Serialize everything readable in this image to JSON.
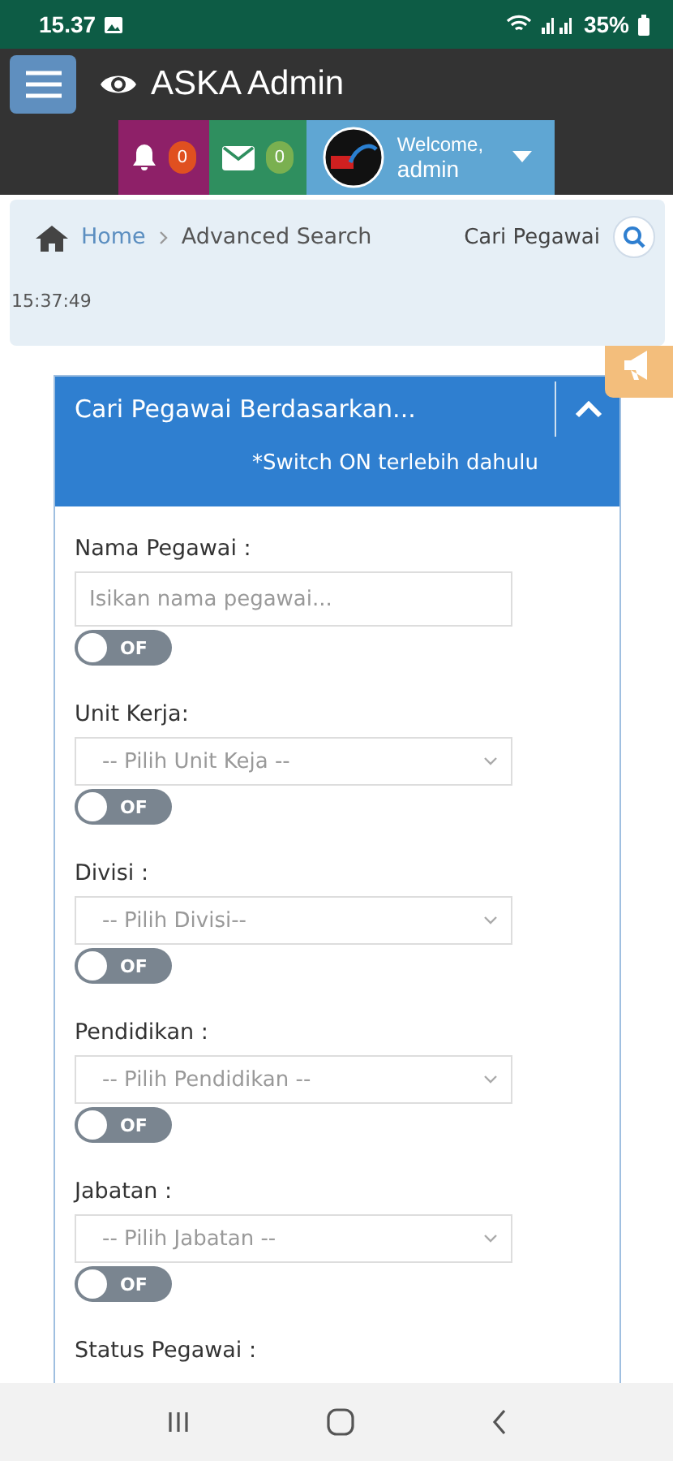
{
  "status_bar": {
    "time": "15.37",
    "battery": "35%"
  },
  "app_bar": {
    "title": "ASKA Admin"
  },
  "header_buttons": {
    "notifications": "0",
    "messages": "0",
    "welcome": "Welcome,",
    "user": "admin"
  },
  "breadcrumb": {
    "items": [
      {
        "label": "Home",
        "kind": "link"
      },
      {
        "label": "Advanced Search",
        "kind": "current"
      }
    ],
    "search_placeholder": "Cari Pegawai",
    "time": "15:37:49"
  },
  "card": {
    "title": "Cari Pegawai Berdasarkan...",
    "note": "*Switch ON terlebih dahulu",
    "expanded": true,
    "fields": [
      {
        "label": "Nama Pegawai :",
        "kind": "input",
        "placeholder": "Isikan nama pegawai...",
        "switch": {
          "on": false,
          "label": "OF"
        }
      },
      {
        "label": "Unit Kerja:",
        "kind": "select",
        "value": "-- Pilih Unit Keja --",
        "switch": {
          "on": false,
          "label": "OF"
        }
      },
      {
        "label": "Divisi :",
        "kind": "select",
        "value": "-- Pilih Divisi--",
        "switch": {
          "on": false,
          "label": "OF"
        }
      },
      {
        "label": "Pendidikan :",
        "kind": "select",
        "value": "-- Pilih Pendidikan --",
        "switch": {
          "on": false,
          "label": "OF"
        }
      },
      {
        "label": "Jabatan :",
        "kind": "select",
        "value": "-- Pilih Jabatan --",
        "switch": {
          "on": false,
          "label": "OF"
        }
      },
      {
        "label": "Status Pegawai :",
        "kind": "label"
      }
    ]
  }
}
